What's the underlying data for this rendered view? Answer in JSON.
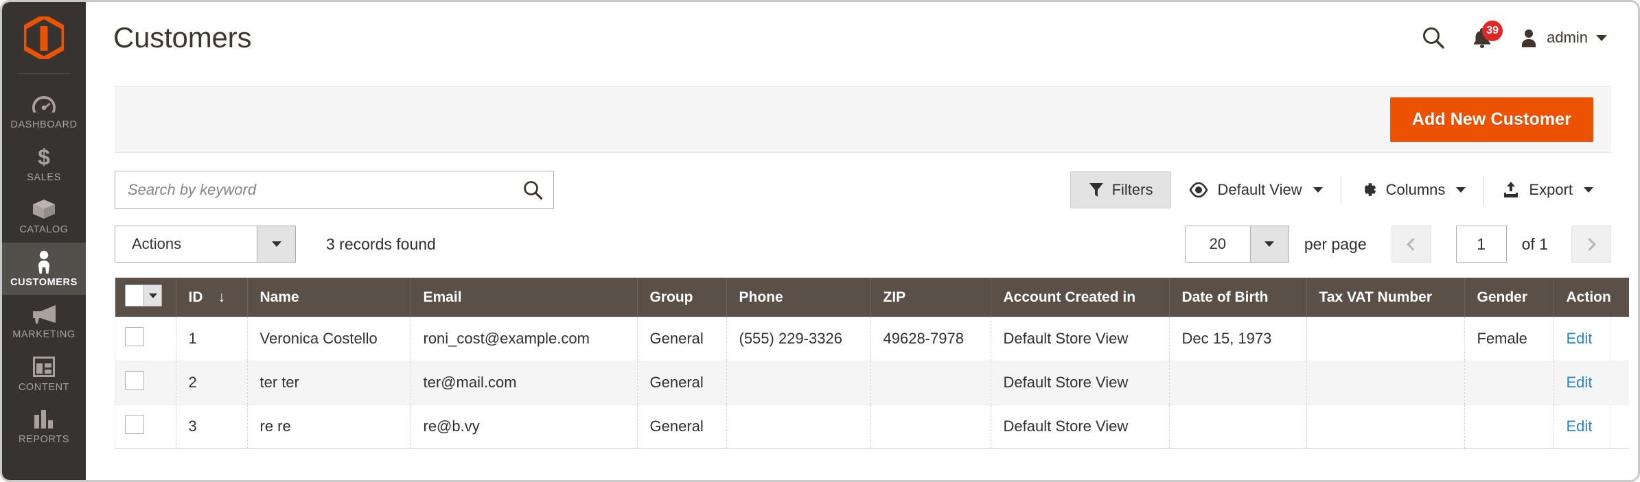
{
  "brand": {
    "logo": "magento-logo",
    "accent": "#eb5202"
  },
  "sidebar": {
    "items": [
      {
        "label": "DASHBOARD",
        "icon": "dashboard-gauge-icon",
        "active": false
      },
      {
        "label": "SALES",
        "icon": "dollar-sign-icon",
        "active": false
      },
      {
        "label": "CATALOG",
        "icon": "box-icon",
        "active": false
      },
      {
        "label": "CUSTOMERS",
        "icon": "person-icon",
        "active": true
      },
      {
        "label": "MARKETING",
        "icon": "megaphone-icon",
        "active": false
      },
      {
        "label": "CONTENT",
        "icon": "layout-window-icon",
        "active": false
      },
      {
        "label": "REPORTS",
        "icon": "bar-chart-icon",
        "active": false
      }
    ]
  },
  "header": {
    "title": "Customers",
    "search_icon": "search-icon",
    "notifications": {
      "icon": "bell-icon",
      "count": "39"
    },
    "user": {
      "icon": "user-avatar-icon",
      "name": "admin",
      "caret": "chevron-down-icon"
    }
  },
  "page_actions": {
    "add_new_customer": "Add New Customer"
  },
  "toolbar": {
    "search_placeholder": "Search by keyword",
    "search_value": "",
    "search_icon": "search-icon",
    "filters": {
      "label": "Filters",
      "icon": "funnel-icon"
    },
    "view": {
      "label": "Default View",
      "icon": "eye-icon",
      "caret": "chevron-down-icon"
    },
    "columns": {
      "label": "Columns",
      "icon": "gear-icon",
      "caret": "chevron-down-icon"
    },
    "export": {
      "label": "Export",
      "icon": "upload-icon",
      "caret": "chevron-down-icon"
    }
  },
  "actions_row": {
    "actions_label": "Actions",
    "records_found": "3 records found",
    "per_page_value": "20",
    "per_page_label": "per page",
    "prev_icon": "chevron-left-icon",
    "next_icon": "chevron-right-icon",
    "page_value": "1",
    "of_pages": "of 1"
  },
  "grid": {
    "columns": [
      "ID",
      "Name",
      "Email",
      "Group",
      "Phone",
      "ZIP",
      "Account Created in",
      "Date of Birth",
      "Tax VAT Number",
      "Gender",
      "Action"
    ],
    "sort": {
      "column": "ID",
      "direction": "desc",
      "glyph": "↓"
    },
    "edit_label": "Edit",
    "rows": [
      {
        "id": "1",
        "name": "Veronica Costello",
        "email": "roni_cost@example.com",
        "group": "General",
        "phone": "(555) 229-3326",
        "zip": "49628-7978",
        "account_created_in": "Default Store View",
        "date_of_birth": "Dec 15, 1973",
        "tax_vat_number": "",
        "gender": "Female",
        "action": "Edit"
      },
      {
        "id": "2",
        "name": "ter ter",
        "email": "ter@mail.com",
        "group": "General",
        "phone": "",
        "zip": "",
        "account_created_in": "Default Store View",
        "date_of_birth": "",
        "tax_vat_number": "",
        "gender": "",
        "action": "Edit"
      },
      {
        "id": "3",
        "name": "re re",
        "email": "re@b.vy",
        "group": "General",
        "phone": "",
        "zip": "",
        "account_created_in": "Default Store View",
        "date_of_birth": "",
        "tax_vat_number": "",
        "gender": "",
        "action": "Edit"
      }
    ]
  }
}
